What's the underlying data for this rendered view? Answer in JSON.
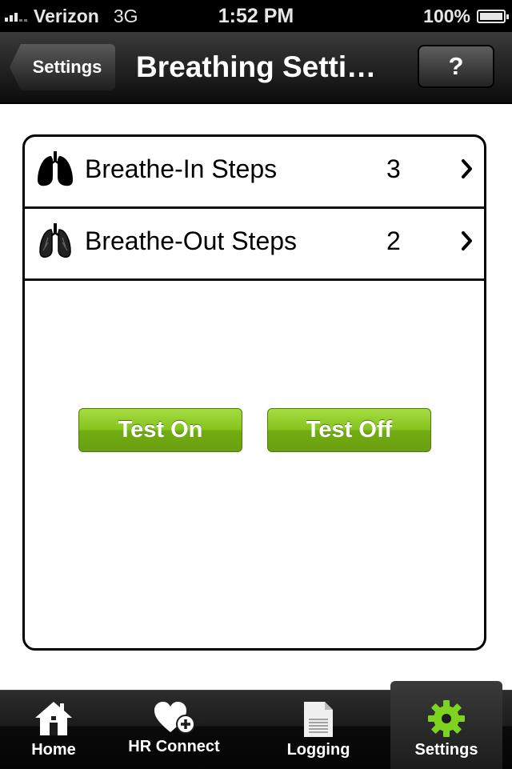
{
  "status_bar": {
    "carrier": "Verizon",
    "network": "3G",
    "time": "1:52 PM",
    "battery": "100%"
  },
  "nav": {
    "back_label": "Settings",
    "title": "Breathing Setti…",
    "help_label": "?"
  },
  "settings_list": [
    {
      "label": "Breathe-In Steps",
      "value": "3",
      "icon": "lungs-filled-icon"
    },
    {
      "label": "Breathe-Out Steps",
      "value": "2",
      "icon": "lungs-outline-icon"
    }
  ],
  "buttons": {
    "test_on": "Test On",
    "test_off": "Test Off"
  },
  "tabs": [
    {
      "label": "Home",
      "icon": "home-icon"
    },
    {
      "label": "HR Connect",
      "icon": "heart-plus-icon"
    },
    {
      "label": "Logging",
      "icon": "document-icon"
    },
    {
      "label": "Settings",
      "icon": "gear-icon",
      "selected": true
    }
  ],
  "colors": {
    "accent_green": "#86c41f",
    "gear_active": "#7ed321",
    "nav_bg": "#1c1c1c"
  }
}
